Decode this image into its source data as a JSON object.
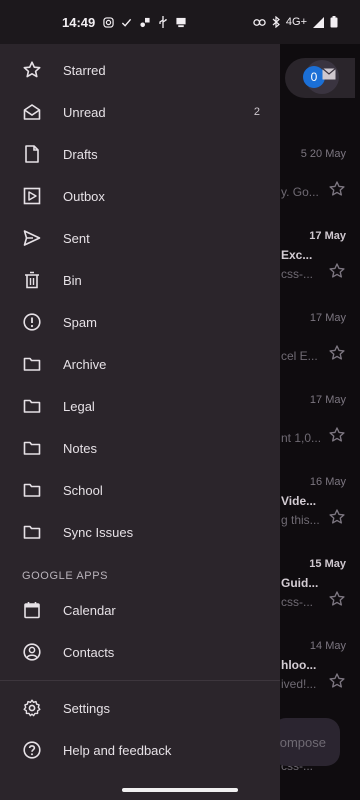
{
  "status_bar": {
    "time": "14:49",
    "network": "4G+"
  },
  "background_inbox": {
    "account_badge": "0",
    "compose_label": "ompose",
    "rows": [
      {
        "date": "5 20 May",
        "bold": false,
        "subject": "",
        "snippet": "y. Go..."
      },
      {
        "date": "17 May",
        "bold": true,
        "subject": "Exc...",
        "snippet": "css-..."
      },
      {
        "date": "17 May",
        "bold": false,
        "subject": "",
        "snippet": "cel E..."
      },
      {
        "date": "17 May",
        "bold": false,
        "subject": "",
        "snippet": "nt 1,0..."
      },
      {
        "date": "16 May",
        "bold": false,
        "subject": "Vide...",
        "snippet": "g this..."
      },
      {
        "date": "15 May",
        "bold": true,
        "subject": "Guid...",
        "snippet": "css-..."
      },
      {
        "date": "14 May",
        "bold": false,
        "subject": "hloo...",
        "snippet": "ived!..."
      },
      {
        "date": "",
        "bold": false,
        "subject": "",
        "snippet": "css-..."
      }
    ]
  },
  "drawer": {
    "items": [
      {
        "label": "Starred",
        "icon": "star-icon"
      },
      {
        "label": "Unread",
        "icon": "open-envelope-icon",
        "count": "2"
      },
      {
        "label": "Drafts",
        "icon": "draft-icon"
      },
      {
        "label": "Outbox",
        "icon": "outbox-icon"
      },
      {
        "label": "Sent",
        "icon": "send-icon"
      },
      {
        "label": "Bin",
        "icon": "trash-icon"
      },
      {
        "label": "Spam",
        "icon": "spam-icon"
      },
      {
        "label": "Archive",
        "icon": "folder-icon"
      },
      {
        "label": "Legal",
        "icon": "folder-icon"
      },
      {
        "label": "Notes",
        "icon": "folder-icon"
      },
      {
        "label": "School",
        "icon": "folder-icon"
      },
      {
        "label": "Sync Issues",
        "icon": "folder-icon"
      }
    ],
    "section_title": "GOOGLE APPS",
    "apps": [
      {
        "label": "Calendar",
        "icon": "calendar-icon"
      },
      {
        "label": "Contacts",
        "icon": "contacts-icon"
      }
    ],
    "footer": [
      {
        "label": "Settings",
        "icon": "gear-icon"
      },
      {
        "label": "Help and feedback",
        "icon": "help-icon"
      }
    ]
  },
  "colors": {
    "drawer_bg": "#2b252b",
    "scrim": "#0f0c0f",
    "text": "#e6e1e6",
    "accent": "#1b6fd6"
  }
}
